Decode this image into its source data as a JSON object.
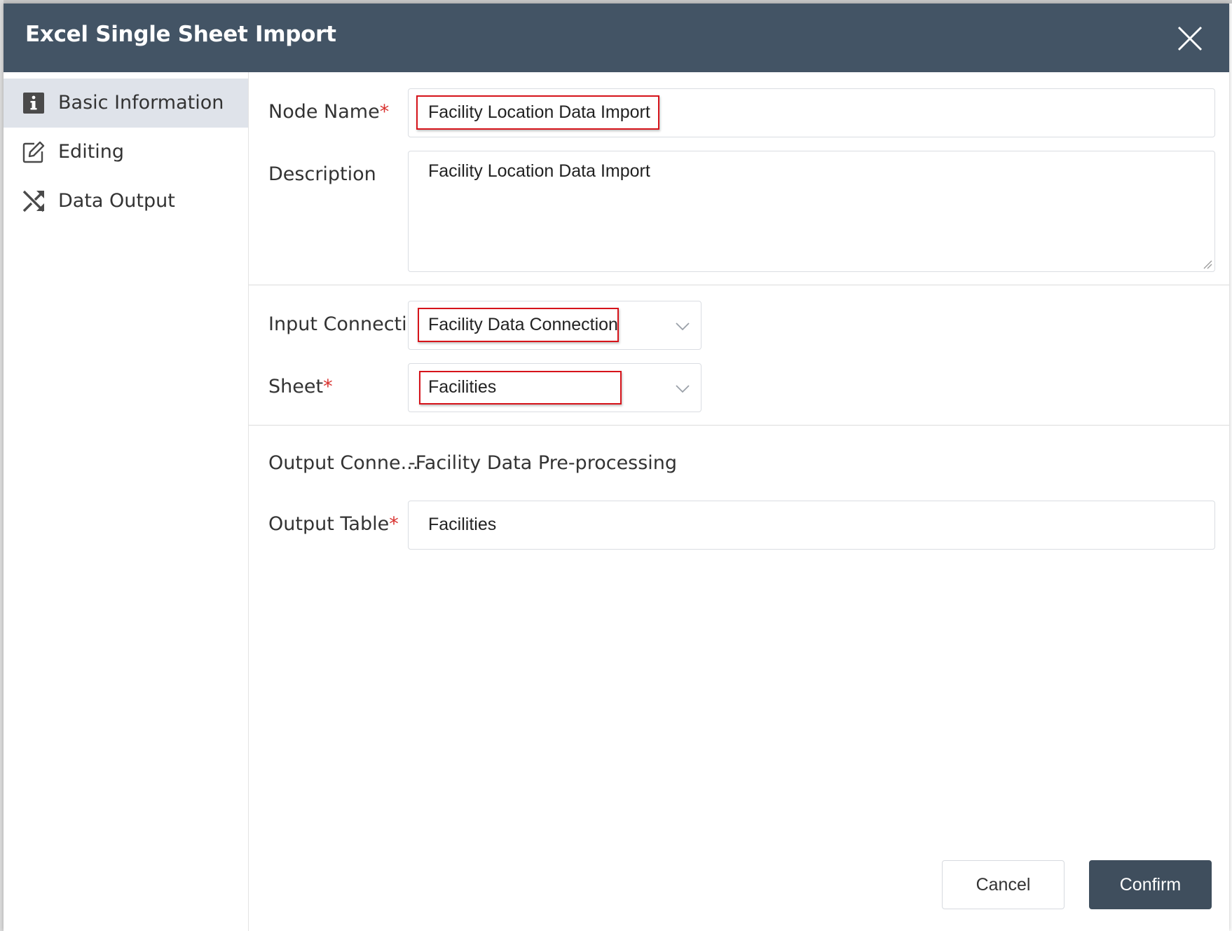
{
  "dialog": {
    "title": "Excel Single Sheet Import",
    "close_icon": "close-icon"
  },
  "sidebar": {
    "items": [
      {
        "label": "Basic Information",
        "icon": "info-icon",
        "active": true
      },
      {
        "label": "Editing",
        "icon": "edit-icon",
        "active": false
      },
      {
        "label": "Data Output",
        "icon": "shuffle-icon",
        "active": false
      }
    ]
  },
  "form": {
    "node_name": {
      "label": "Node Name",
      "required_mark": "*",
      "value": "Facility Location Data Import"
    },
    "description": {
      "label": "Description",
      "value": "Facility Location Data Import"
    },
    "input_connection": {
      "label": "Input Connecti...",
      "value": "Facility Data Connection"
    },
    "sheet": {
      "label": "Sheet",
      "required_mark": "*",
      "value": "Facilities"
    },
    "output_connection": {
      "label": "Output Conne...",
      "value": "-Facility Data Pre-processing"
    },
    "output_table": {
      "label": "Output Table",
      "required_mark": "*",
      "value": "Facilities"
    }
  },
  "buttons": {
    "cancel": "Cancel",
    "confirm": "Confirm"
  },
  "colors": {
    "header": "#435465",
    "active_nav": "#dfe3ea",
    "required": "#d8322f",
    "highlight": "#d6131a",
    "confirm": "#3f4e5d"
  }
}
